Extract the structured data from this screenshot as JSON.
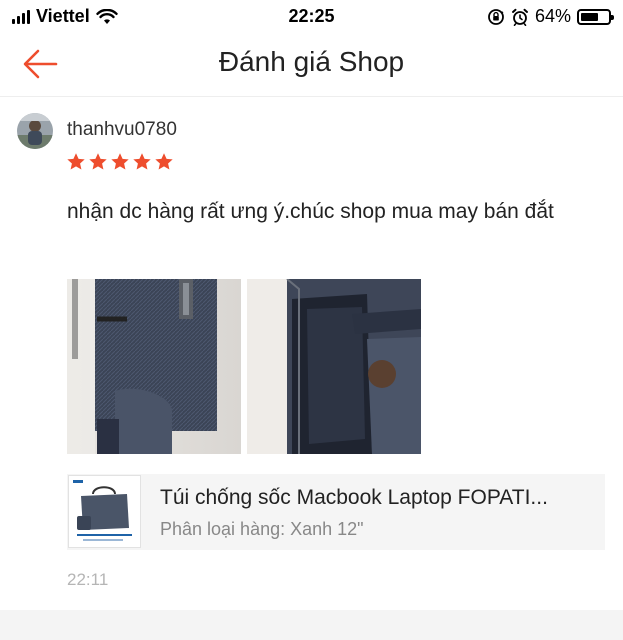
{
  "status_bar": {
    "carrier": "Viettel",
    "time": "22:25",
    "battery": "64%",
    "battery_level": 0.64
  },
  "header": {
    "title": "Đánh giá Shop",
    "accent_color": "#ee4d2d"
  },
  "review": {
    "username": "thanhvu0780",
    "rating": 5,
    "max_rating": 5,
    "star_color": "#ee4d2d",
    "text": "nhận dc hàng rất ưng ý.chúc shop mua may bán đắt",
    "time": "22:11",
    "photos": [
      "review-photo-bag-front",
      "review-photo-bag-open"
    ]
  },
  "product": {
    "name": "Túi chống sốc Macbook Laptop FOPATI...",
    "variant": "Phân loại hàng: Xanh 12\""
  }
}
